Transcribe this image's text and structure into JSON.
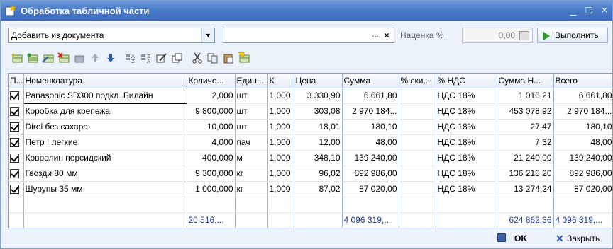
{
  "window": {
    "title": "Обработка табличной части",
    "controls": [
      "_",
      "□",
      "×"
    ]
  },
  "toolbar": {
    "mode_select_value": "Добавить из документа",
    "second_select_value": "",
    "markup_label": "Наценка %",
    "markup_value": "0,00",
    "execute_label": "Выполнить"
  },
  "icons": [
    "add-row-icon",
    "add-copy-icon",
    "edit-row-icon",
    "delete-row-icon",
    "end-edit-icon",
    "move-up-icon",
    "move-down-icon",
    "sort-asc-icon",
    "sort-desc-icon",
    "edit-icon",
    "copy-icon",
    "cut-icon",
    "copy-clipboard-icon",
    "paste-icon",
    "select-fill-icon"
  ],
  "table": {
    "headers": [
      "П...",
      "Номенклатура",
      "Количе...",
      "Един...",
      "К",
      "Цена",
      "Сумма",
      "% ски...",
      "% НДС",
      "Сумма Н...",
      "Всего"
    ],
    "rows": [
      {
        "checked": true,
        "name": "Panasonic SD300 подкл. Билайн",
        "qty": "2,000",
        "unit": "шт",
        "k": "1,000",
        "price": "3 330,90",
        "sum": "6 661,80",
        "discount": "",
        "vat": "НДС 18%",
        "vat_sum": "1 016,21",
        "total": "6 661,80"
      },
      {
        "checked": true,
        "name": "Коробка для крепежа",
        "qty": "9 800,000",
        "unit": "шт",
        "k": "1,000",
        "price": "303,08",
        "sum": "2 970 184...",
        "discount": "",
        "vat": "НДС 18%",
        "vat_sum": "453 078,92",
        "total": "2 970 184..."
      },
      {
        "checked": true,
        "name": "Dirol без сахара",
        "qty": "10,000",
        "unit": "шт",
        "k": "1,000",
        "price": "18,01",
        "sum": "180,10",
        "discount": "",
        "vat": "НДС 18%",
        "vat_sum": "27,47",
        "total": "180,10"
      },
      {
        "checked": true,
        "name": "Петр I легкие",
        "qty": "4,000",
        "unit": "пач",
        "k": "1,000",
        "price": "12,00",
        "sum": "48,00",
        "discount": "",
        "vat": "НДС 18%",
        "vat_sum": "7,32",
        "total": "48,00"
      },
      {
        "checked": true,
        "name": "Ковролин персидский",
        "qty": "400,000",
        "unit": "м",
        "k": "1,000",
        "price": "348,10",
        "sum": "139 240,00",
        "discount": "",
        "vat": "НДС 18%",
        "vat_sum": "21 240,00",
        "total": "139 240,00"
      },
      {
        "checked": true,
        "name": "Гвозди 80 мм",
        "qty": "9 300,000",
        "unit": "кг",
        "k": "1,000",
        "price": "96,02",
        "sum": "892 986,00",
        "discount": "",
        "vat": "НДС 18%",
        "vat_sum": "136 218,20",
        "total": "892 986,00"
      },
      {
        "checked": true,
        "name": "Шурупы 35 мм",
        "qty": "1 000,000",
        "unit": "кг",
        "k": "1,000",
        "price": "87,02",
        "sum": "87 020,00",
        "discount": "",
        "vat": "НДС 18%",
        "vat_sum": "13 274,24",
        "total": "87 020,00"
      }
    ],
    "totals": {
      "qty": "20 516,...",
      "sum": "4 096 319,...",
      "vat_sum": "624 862,36",
      "total": "4 096 319,..."
    }
  },
  "footer": {
    "ok_label": "OK",
    "close_label": "Закрыть"
  },
  "colors": {
    "title_bar": "#4a7cc9",
    "accent_green": "#2e9a2e",
    "window_bg": "#ecf2fb"
  }
}
